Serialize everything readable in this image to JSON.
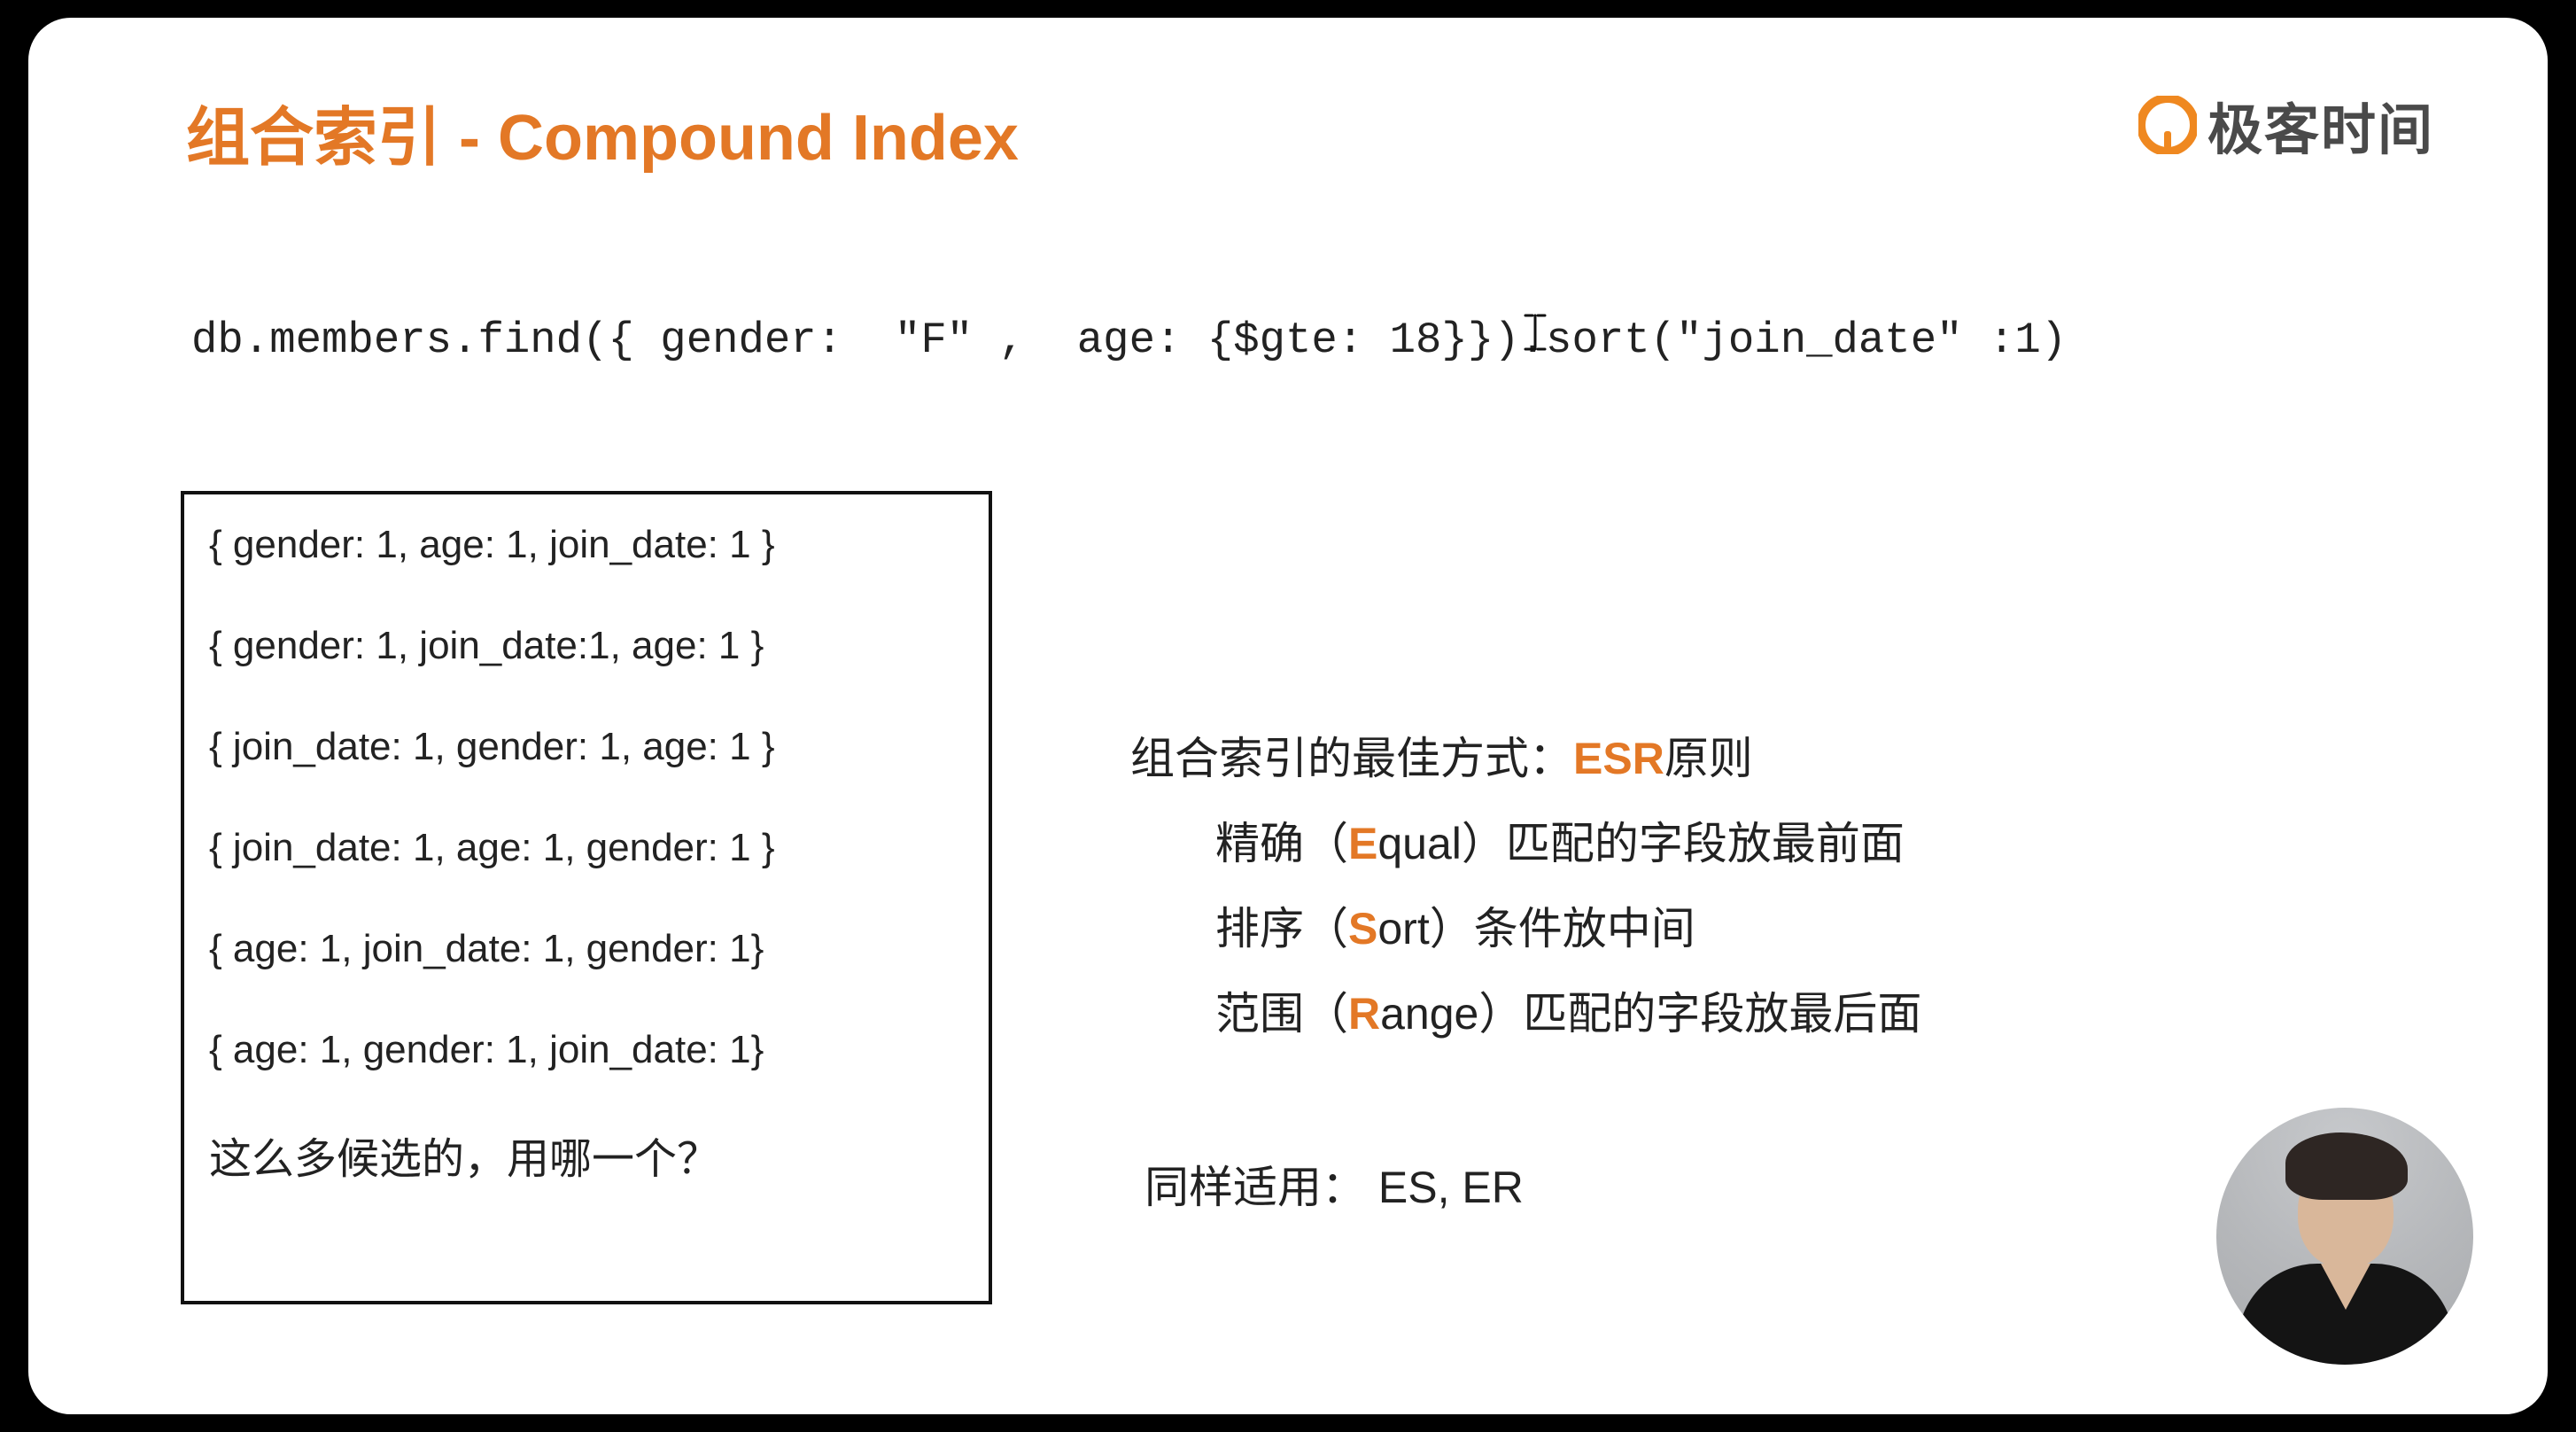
{
  "title": "组合索引 - Compound Index",
  "logo_text": "极客时间",
  "code_line": "db.members.find({ gender:  \"F\" ,  age: {$gte: 18}}).sort(\"join_date\" :1)",
  "candidates": [
    "{ gender: 1, age: 1, join_date: 1 }",
    "{ gender: 1, join_date:1, age: 1 }",
    "{ join_date: 1, gender: 1, age: 1 }",
    "{ join_date: 1, age: 1, gender: 1 }",
    "{ age: 1, join_date: 1, gender: 1}",
    "{ age: 1, gender: 1, join_date: 1}"
  ],
  "candidates_question": "这么多候选的，用哪一个？",
  "esr": {
    "heading_pre": "组合索引的最佳方式：",
    "heading_accent": "ESR",
    "heading_post": "原则",
    "rules": [
      {
        "pre": "精确（",
        "letter": "E",
        "post": "qual）匹配的字段放最前面"
      },
      {
        "pre": "排序（",
        "letter": "S",
        "post": "ort）条件放中间"
      },
      {
        "pre": "范围（",
        "letter": "R",
        "post": "ange）匹配的字段放最后面"
      }
    ]
  },
  "also_applies": "同样适用：   ES, ER"
}
